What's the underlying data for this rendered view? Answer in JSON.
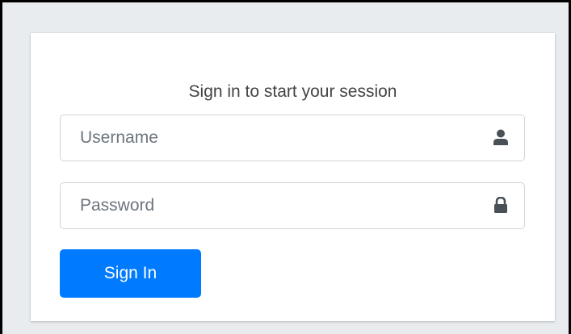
{
  "login": {
    "message": "Sign in to start your session",
    "username": {
      "placeholder": "Username",
      "value": "",
      "icon": "user-icon"
    },
    "password": {
      "placeholder": "Password",
      "value": "",
      "icon": "lock-icon"
    },
    "submit_label": "Sign In"
  },
  "colors": {
    "background": "#e9ecef",
    "card": "#ffffff",
    "primary": "#007bff",
    "icon": "#495057"
  }
}
